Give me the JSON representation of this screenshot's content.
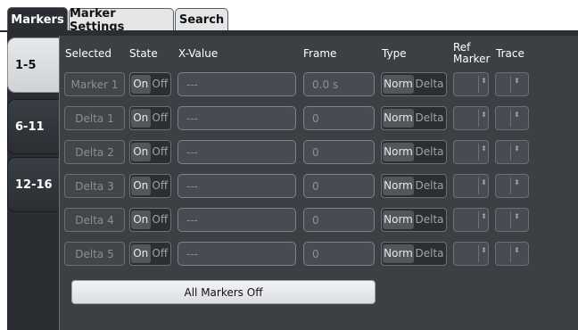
{
  "top_tabs": [
    {
      "label": "Markers",
      "active": true
    },
    {
      "label": "Marker Settings",
      "active": false
    },
    {
      "label": "Search",
      "active": false
    }
  ],
  "side_tabs": [
    {
      "label": "1-5",
      "active": true
    },
    {
      "label": "6-11",
      "active": false
    },
    {
      "label": "12-16",
      "active": false
    }
  ],
  "headers": {
    "selected": "Selected",
    "state": "State",
    "x_value": "X-Value",
    "frame": "Frame",
    "type": "Type",
    "ref_marker_line1": "Ref",
    "ref_marker_line2": "Marker",
    "trace": "Trace"
  },
  "toggle_labels": {
    "on": "On",
    "off": "Off",
    "norm": "Norm",
    "delta": "Delta"
  },
  "spinner_glyph": "⬍",
  "rows": [
    {
      "name": "Marker 1",
      "x_value": "---",
      "frame": "0.0 s"
    },
    {
      "name": "Delta 1",
      "x_value": "---",
      "frame": "0"
    },
    {
      "name": "Delta 2",
      "x_value": "---",
      "frame": "0"
    },
    {
      "name": "Delta 3",
      "x_value": "---",
      "frame": "0"
    },
    {
      "name": "Delta 4",
      "x_value": "---",
      "frame": "0"
    },
    {
      "name": "Delta 5",
      "x_value": "---",
      "frame": "0"
    }
  ],
  "all_markers_off_label": "All Markers Off"
}
